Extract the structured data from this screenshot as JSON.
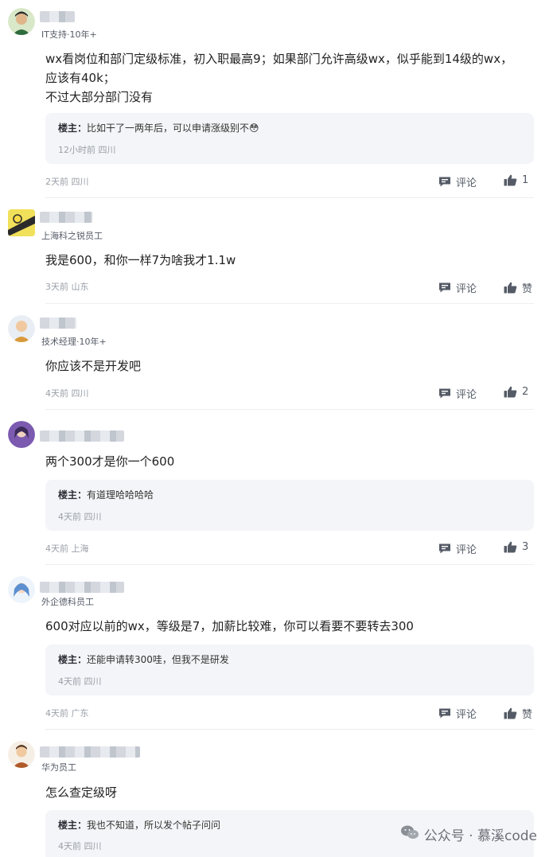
{
  "comments": [
    {
      "role": "IT支持·10年+",
      "body": "wx看岗位和部门定级标准，初入职最高9；如果部门允许高级wx，似乎能到14级的wx，\n应该有40k；\n不过大部分部门没有",
      "reply": {
        "author": "楼主：",
        "text": "比如干了一两年后，可以申请涨级别不",
        "emoji": "😳",
        "meta": "12小时前 四川"
      },
      "meta": "2天前 四川",
      "comment_label": "评论",
      "like_label": "1"
    },
    {
      "role": "上海科之锐员工",
      "body": "我是600，和你一样7为啥我才1.1w",
      "meta": "3天前 山东",
      "comment_label": "评论",
      "like_label": "赞"
    },
    {
      "role": "技术经理·10年+",
      "body": "你应该不是开发吧",
      "meta": "4天前 四川",
      "comment_label": "评论",
      "like_label": "2"
    },
    {
      "role": "",
      "body": "两个300才是你一个600",
      "reply": {
        "author": "楼主：",
        "text": "有道理哈哈哈哈",
        "meta": "4天前 四川"
      },
      "meta": "4天前 上海",
      "comment_label": "评论",
      "like_label": "3"
    },
    {
      "role": "外企德科员工",
      "body": "600对应以前的wx，等级是7，加薪比较难，你可以看要不要转去300",
      "reply": {
        "author": "楼主：",
        "text": "还能申请转300哇，但我不是研发",
        "meta": "4天前 四川"
      },
      "meta": "4天前 广东",
      "comment_label": "评论",
      "like_label": "赞"
    },
    {
      "role": "华为员工",
      "body": "怎么查定级呀",
      "reply": {
        "author": "楼主：",
        "text": "我也不知道，所以发个帖子问问",
        "meta": "4天前 四川"
      }
    }
  ],
  "watermark": "公众号 · 慕溪code",
  "icons": {
    "comment": "comment-bubble-icon",
    "like": "thumbs-up-icon",
    "watermark": "wechat-icon"
  },
  "colors": {
    "text": "#222222",
    "meta": "#9aa0a8",
    "reply_bg": "#f4f5f8",
    "divider": "#eceef2"
  }
}
